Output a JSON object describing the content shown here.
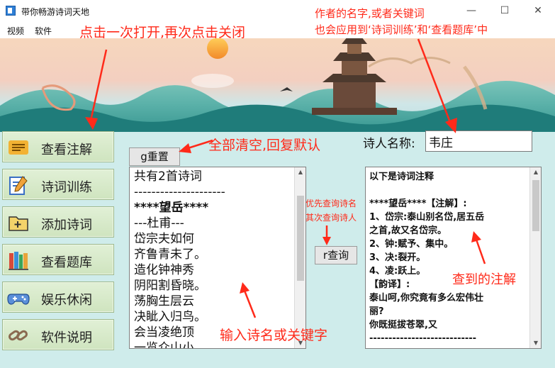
{
  "window": {
    "title": "带你畅游诗词天地",
    "minimize": "—",
    "maximize": "☐",
    "close": "✕"
  },
  "menu": {
    "items": [
      "视频",
      "软件"
    ]
  },
  "nav": [
    {
      "label": "查看注解",
      "icon": "notes-icon"
    },
    {
      "label": "诗词训练",
      "icon": "pencil-paper-icon"
    },
    {
      "label": "添加诗词",
      "icon": "folder-add-icon"
    },
    {
      "label": "查看题库",
      "icon": "books-icon"
    },
    {
      "label": "娱乐休闲",
      "icon": "gamepad-icon"
    },
    {
      "label": "软件说明",
      "icon": "chain-link-icon"
    }
  ],
  "reset_button": "g重置",
  "query_button": "r查询",
  "poet": {
    "label": "诗人名称:",
    "value": "韦庄"
  },
  "left_text": {
    "lines": [
      "共有2首诗词",
      "---------------------",
      "****望岳****",
      "---杜甫---",
      "岱宗夫如何",
      "齐鲁青未了。",
      "造化钟神秀",
      "阴阳割昏晓。",
      "荡胸生层云",
      "决眦入归鸟。",
      "会当凌绝顶",
      "一览众山小。"
    ]
  },
  "right_text": {
    "lines": [
      "以下是诗词注释",
      "",
      "****望岳****【注解】:",
      " 1、岱宗:泰山别名岱,居五岳",
      "之首,故又名岱宗。",
      " 2、钟:赋予、集中。",
      " 3、决:裂开。",
      " 4、凌:跃上。",
      "【韵译】:",
      "泰山呵,你究竟有多么宏伟壮",
      "丽?",
      "你既挺拔苍翠,又",
      "----------------------------"
    ]
  },
  "annotations": {
    "menu_hint": "点击一次打开,再次点击关闭",
    "top_right_1": "作者的名字,或者关键词",
    "top_right_2": "也会应用到‘诗词训练’和‘查看题库’中",
    "reset_hint": "全部清空,回复默认",
    "query_hint_1": "优先查询诗名",
    "query_hint_2": "其次查询诗人",
    "input_hint": "输入诗名或关键字",
    "result_hint": "查到的注解"
  },
  "colors": {
    "annotation": "#ff2a1a",
    "panel_bg": "#cfeceb",
    "nav_bg": "#d6e9c8"
  }
}
